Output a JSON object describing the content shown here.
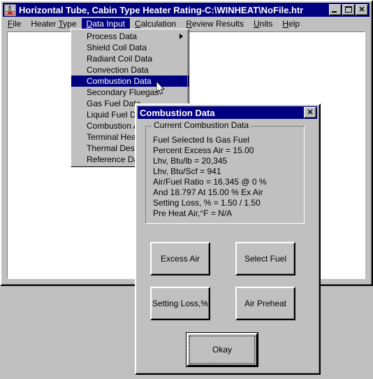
{
  "window": {
    "title": "Horizontal Tube, Cabin Type Heater Rating-C:\\WINHEAT\\NoFile.htr",
    "icon": "heater-icon",
    "buttons": {
      "minimize": "Minimize",
      "maximize": "Maximize",
      "close": "✕"
    }
  },
  "menubar": {
    "items": [
      {
        "label": "File",
        "mnemonic": "F",
        "selected": false
      },
      {
        "label": "Heater Type",
        "mnemonic": "T",
        "selected": false
      },
      {
        "label": "Data Input",
        "mnemonic": "D",
        "selected": true
      },
      {
        "label": "Calculation",
        "mnemonic": "C",
        "selected": false
      },
      {
        "label": "Review Results",
        "mnemonic": "R",
        "selected": false
      },
      {
        "label": "Units",
        "mnemonic": "U",
        "selected": false
      },
      {
        "label": "Help",
        "mnemonic": "H",
        "selected": false
      }
    ]
  },
  "dropdown": {
    "owner": "Data Input",
    "items": [
      {
        "label": "Process Data",
        "submenu": true,
        "highlight": false
      },
      {
        "label": "Shield Coil Data",
        "submenu": false,
        "highlight": false
      },
      {
        "label": "Radiant Coil Data",
        "submenu": false,
        "highlight": false
      },
      {
        "label": "Convection Data",
        "submenu": false,
        "highlight": false
      },
      {
        "label": "Combustion Data",
        "submenu": false,
        "highlight": true
      },
      {
        "label": "Secondary Fluegas",
        "submenu": false,
        "highlight": false
      },
      {
        "label": "Gas Fuel Data",
        "submenu": false,
        "highlight": false
      },
      {
        "label": "Liquid Fuel Data",
        "submenu": false,
        "highlight": false
      },
      {
        "label": "Combustion Air",
        "submenu": false,
        "highlight": false
      },
      {
        "label": "Terminal Heater",
        "submenu": false,
        "highlight": false
      },
      {
        "label": "Thermal Design",
        "submenu": false,
        "highlight": false
      },
      {
        "label": "Reference Data",
        "submenu": false,
        "highlight": false
      }
    ]
  },
  "dialog": {
    "title": "Combustion Data",
    "close_label": "✕",
    "groupbox": {
      "legend": "Current Combustion Data",
      "lines": [
        "Fuel Selected Is Gas Fuel",
        "Percent Excess Air = 15.00",
        "Lhv, Btu/lb = 20,345",
        "Lhv, Btu/Scf = 941",
        "Air/Fuel Ratio  = 16.345 @ 0 %",
        "And 18.797 At 15.00 % Ex Air",
        "Setting Loss, % = 1.50 / 1.50",
        "Pre Heat Air,°F = N/A"
      ]
    },
    "buttons": {
      "excess_air": "Excess Air",
      "select_fuel": "Select Fuel",
      "setting_loss": "Setting Loss,%",
      "air_preheat": "Air Preheat",
      "okay": "Okay"
    }
  },
  "colors": {
    "titlebar_active": "#000080",
    "face": "#c0c0c0",
    "desktop": "#bfbfbf",
    "highlight_text": "#ffffff",
    "client": "#ffffff"
  }
}
